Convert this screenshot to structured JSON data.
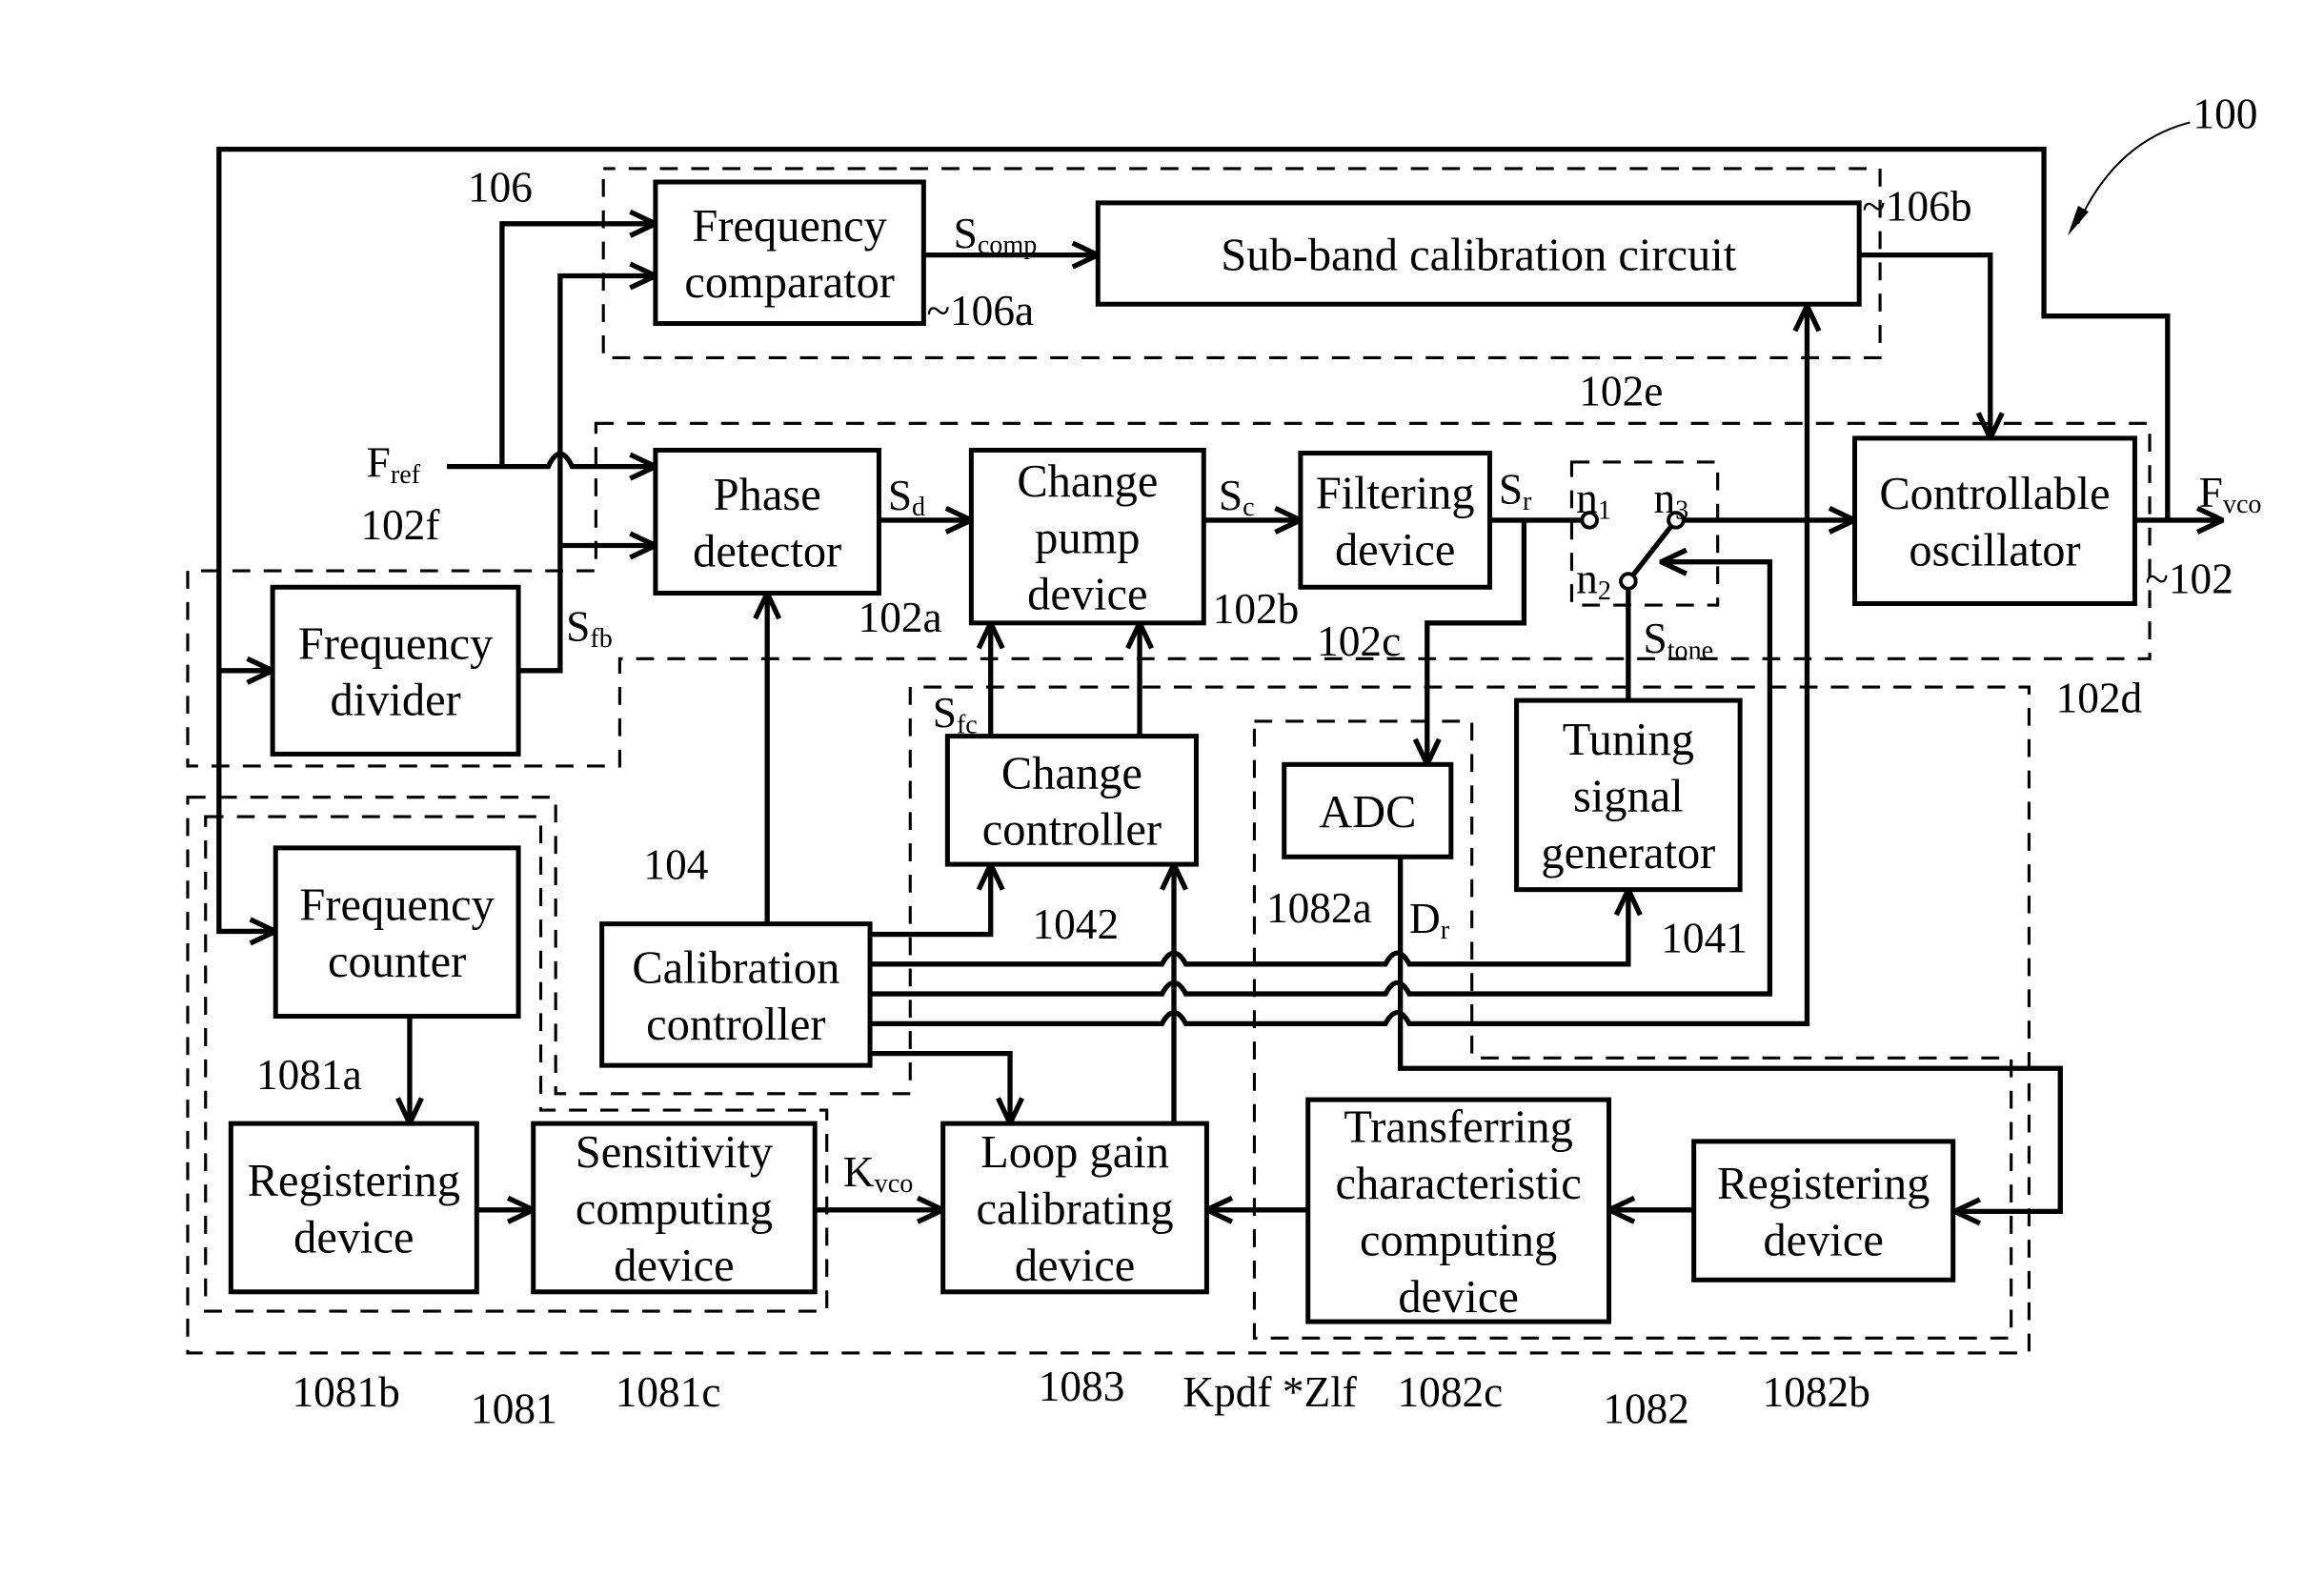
{
  "figure_ref": "100",
  "blocks": {
    "freq_comparator": {
      "lines": [
        "Frequency",
        "comparator"
      ],
      "ref": "~106a"
    },
    "subband_cal": {
      "lines": [
        "Sub-band calibration circuit"
      ],
      "ref": "~106b"
    },
    "phase_detector": {
      "lines": [
        "Phase",
        "detector"
      ],
      "ref": "102a"
    },
    "charge_pump": {
      "lines": [
        "Change",
        "pump",
        "device"
      ],
      "ref": "102b"
    },
    "filtering": {
      "lines": [
        "Filtering",
        "device"
      ],
      "ref": "102c"
    },
    "controllable_osc": {
      "lines": [
        "Controllable",
        "oscillator"
      ],
      "ref": "102d"
    },
    "freq_divider": {
      "lines": [
        "Frequency",
        "divider"
      ],
      "ref": "102f"
    },
    "change_controller": {
      "lines": [
        "Change",
        "controller"
      ],
      "ref": "1042"
    },
    "adc": {
      "lines": [
        "ADC"
      ],
      "ref": "1082a"
    },
    "tuning_gen": {
      "lines": [
        "Tuning",
        "signal",
        "generator"
      ],
      "ref": "1041"
    },
    "cal_controller": {
      "lines": [
        "Calibration",
        "controller"
      ],
      "ref": "104"
    },
    "freq_counter": {
      "lines": [
        "Frequency",
        "counter"
      ],
      "ref": "1081a"
    },
    "registering_1": {
      "lines": [
        "Registering",
        "device"
      ],
      "ref": "1081b"
    },
    "sensitivity": {
      "lines": [
        "Sensitivity",
        "computing",
        "device"
      ],
      "ref": "1081c"
    },
    "loop_gain": {
      "lines": [
        "Loop gain",
        "calibrating",
        "device"
      ],
      "ref": "1083"
    },
    "transferring": {
      "lines": [
        "Transferring",
        "characteristic",
        "computing",
        "device"
      ],
      "ref": "1082c"
    },
    "registering_2": {
      "lines": [
        "Registering",
        "device"
      ],
      "ref": "1082b"
    }
  },
  "groups": {
    "g106": "106",
    "g102": "~102",
    "g102e": "102e",
    "g1081": "1081",
    "g1082": "1082"
  },
  "signals": {
    "fref": {
      "main": "F",
      "sub": "ref"
    },
    "fvco": {
      "main": "F",
      "sub": "vco"
    },
    "scomp": {
      "main": "S",
      "sub": "comp"
    },
    "sd": {
      "main": "S",
      "sub": "d"
    },
    "sc": {
      "main": "S",
      "sub": "c"
    },
    "sr": {
      "main": "S",
      "sub": "r"
    },
    "sfb": {
      "main": "S",
      "sub": "fb"
    },
    "sfc": {
      "main": "S",
      "sub": "fc"
    },
    "stone": {
      "main": "S",
      "sub": "tone"
    },
    "dr": {
      "main": "D",
      "sub": "r"
    },
    "kvco": {
      "main": "K",
      "sub": "vco"
    },
    "kpdf": {
      "main": "Kpdf *Zlf",
      "sub": ""
    }
  },
  "switch_nodes": {
    "n1": {
      "main": "n",
      "sub": "1"
    },
    "n2": {
      "main": "n",
      "sub": "2"
    },
    "n3": {
      "main": "n",
      "sub": "3"
    }
  }
}
